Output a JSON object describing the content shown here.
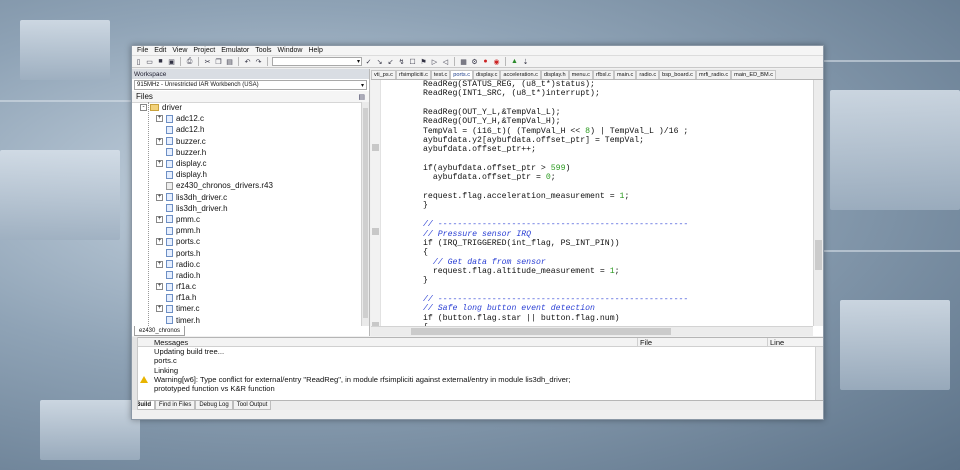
{
  "menu": [
    "File",
    "Edit",
    "View",
    "Project",
    "Emulator",
    "Tools",
    "Window",
    "Help"
  ],
  "workspace": {
    "title": "Workspace",
    "config": "915MHz - Unrestricted IAR Workbench (USA)",
    "files_header": "Files",
    "tab": "ez430_chronos",
    "tree": [
      {
        "label": "driver",
        "kind": "folder",
        "level": 0,
        "expander": "-"
      },
      {
        "label": "adc12.c",
        "kind": "file",
        "level": 1,
        "expander": "+"
      },
      {
        "label": "adc12.h",
        "kind": "file",
        "level": 1,
        "expander": ""
      },
      {
        "label": "buzzer.c",
        "kind": "file",
        "level": 1,
        "expander": "+"
      },
      {
        "label": "buzzer.h",
        "kind": "file",
        "level": 1,
        "expander": ""
      },
      {
        "label": "display.c",
        "kind": "file",
        "level": 1,
        "expander": "+"
      },
      {
        "label": "display.h",
        "kind": "file",
        "level": 1,
        "expander": ""
      },
      {
        "label": "ez430_chronos_drivers.r43",
        "kind": "lib",
        "level": 1,
        "expander": ""
      },
      {
        "label": "lis3dh_driver.c",
        "kind": "file",
        "level": 1,
        "expander": "+"
      },
      {
        "label": "lis3dh_driver.h",
        "kind": "file",
        "level": 1,
        "expander": ""
      },
      {
        "label": "pmm.c",
        "kind": "file",
        "level": 1,
        "expander": "+"
      },
      {
        "label": "pmm.h",
        "kind": "file",
        "level": 1,
        "expander": ""
      },
      {
        "label": "ports.c",
        "kind": "file",
        "level": 1,
        "expander": "+"
      },
      {
        "label": "ports.h",
        "kind": "file",
        "level": 1,
        "expander": ""
      },
      {
        "label": "radio.c",
        "kind": "file",
        "level": 1,
        "expander": "+"
      },
      {
        "label": "radio.h",
        "kind": "file",
        "level": 1,
        "expander": ""
      },
      {
        "label": "rf1a.c",
        "kind": "file",
        "level": 1,
        "expander": "+"
      },
      {
        "label": "rf1a.h",
        "kind": "file",
        "level": 1,
        "expander": ""
      },
      {
        "label": "timer.c",
        "kind": "file",
        "level": 1,
        "expander": "+"
      },
      {
        "label": "timer.h",
        "kind": "file",
        "level": 1,
        "expander": ""
      }
    ]
  },
  "editor": {
    "tabs": [
      {
        "label": "vti_ps.c",
        "active": false
      },
      {
        "label": "rfsimpliciti.c",
        "active": false
      },
      {
        "label": "test.c",
        "active": false
      },
      {
        "label": "ports.c",
        "active": true
      },
      {
        "label": "display.c",
        "active": false
      },
      {
        "label": "acceleration.c",
        "active": false
      },
      {
        "label": "display.h",
        "active": false
      },
      {
        "label": "menu.c",
        "active": false
      },
      {
        "label": "rfbsl.c",
        "active": false
      },
      {
        "label": "main.c",
        "active": false
      },
      {
        "label": "radio.c",
        "active": false
      },
      {
        "label": "bsp_board.c",
        "active": false
      },
      {
        "label": "mrfi_radio.c",
        "active": false
      },
      {
        "label": "main_ED_BM.c",
        "active": false
      }
    ],
    "lines": [
      [
        {
          "t": "ReadReg(STATUS_REG, (u8_t*)status);"
        }
      ],
      [
        {
          "t": "ReadReg(INT1_SRC, (u8_t*)interrupt);"
        }
      ],
      [
        {
          "t": ""
        }
      ],
      [
        {
          "t": "ReadReg(OUT_Y_L,&TempVal_L);"
        }
      ],
      [
        {
          "t": "ReadReg(OUT_Y_H,&TempVal_H);"
        }
      ],
      [
        {
          "t": "TempVal = (i16_t)( (TempVal_H << "
        },
        {
          "t": "8",
          "c": "num"
        },
        {
          "t": ") | TempVal_L )/16 ;"
        }
      ],
      [
        {
          "t": "aybufdata.y2[aybufdata.offset_ptr] = TempVal;"
        }
      ],
      [
        {
          "t": "aybufdata.offset_ptr++;"
        }
      ],
      [
        {
          "t": ""
        }
      ],
      [
        {
          "t": "if(aybufdata.offset_ptr > "
        },
        {
          "t": "599",
          "c": "num"
        },
        {
          "t": ")"
        }
      ],
      [
        {
          "t": "  aybufdata.offset_ptr = "
        },
        {
          "t": "0",
          "c": "num"
        },
        {
          "t": ";"
        }
      ],
      [
        {
          "t": ""
        }
      ],
      [
        {
          "t": "request.flag.acceleration_measurement = "
        },
        {
          "t": "1",
          "c": "num"
        },
        {
          "t": ";"
        }
      ],
      [
        {
          "t": "}"
        }
      ],
      [
        {
          "t": ""
        }
      ],
      [
        {
          "t": "// ---------------------------------------------------",
          "c": "cm"
        }
      ],
      [
        {
          "t": "// Pressure sensor IRQ",
          "c": "cm"
        }
      ],
      [
        {
          "t": "if (IRQ_TRIGGERED(int_flag, PS_INT_PIN))"
        }
      ],
      [
        {
          "t": "{"
        }
      ],
      [
        {
          "t": "  "
        },
        {
          "t": "// Get data from sensor",
          "c": "cm"
        }
      ],
      [
        {
          "t": "  request.flag.altitude_measurement = "
        },
        {
          "t": "1",
          "c": "num"
        },
        {
          "t": ";"
        }
      ],
      [
        {
          "t": "}"
        }
      ],
      [
        {
          "t": ""
        }
      ],
      [
        {
          "t": "// ---------------------------------------------------",
          "c": "cm"
        }
      ],
      [
        {
          "t": "// Safe long button event detection",
          "c": "cm"
        }
      ],
      [
        {
          "t": "if (button.flag.star || button.flag.num)"
        }
      ],
      [
        {
          "t": "{"
        }
      ],
      [
        {
          "t": "  "
        },
        {
          "t": "// Additional debounce delay to enable safe high detection - 50ms",
          "c": "cm"
        }
      ],
      [
        {
          "t": "  Timer0_A4_Delay(CONV_MS_TO_TICKS(BUTTONS_DEBOUNCE_TIME_LEFT));"
        }
      ]
    ]
  },
  "messages": {
    "col_messages": "Messages",
    "col_file": "File",
    "col_line": "Line",
    "rows": [
      {
        "text": "Updating build tree...",
        "warn": false
      },
      {
        "text": "ports.c",
        "warn": false
      },
      {
        "text": "Linking",
        "warn": false
      },
      {
        "text": "Warning[w6]: Type conflict for external/entry \"ReadReg\", in module rfsimpliciti against external/entry in module lis3dh_driver;",
        "warn": true
      },
      {
        "text": "prototyped function vs K&R function",
        "warn": false
      }
    ],
    "tabs": [
      "Build",
      "Find in Files",
      "Debug Log",
      "Tool Output"
    ]
  }
}
